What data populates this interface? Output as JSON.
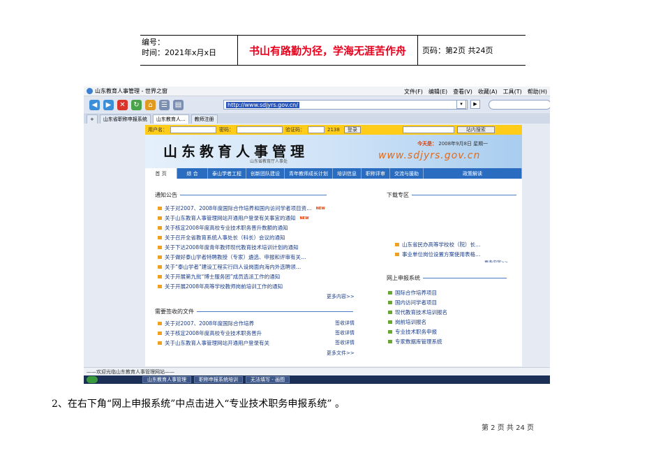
{
  "doc_header": {
    "number_label": "编号：",
    "time_label": "时间：2021年x月x日",
    "motto": "书山有路勤为径，学海无涯苦作舟",
    "page_label": "页码：第2页 共24页"
  },
  "browser": {
    "title": "山东教育人事管理 - 世界之窗",
    "menus": [
      "文件(F)",
      "编辑(E)",
      "查看(V)",
      "收藏(A)",
      "工具(T)",
      "帮助(H)"
    ],
    "address": "http://www.sdjyrs.gov.cn/",
    "tabs": [
      "山东省职称申报系统",
      "山东教育人...",
      "教师注册"
    ]
  },
  "site": {
    "login": {
      "user_label": "用户名：",
      "password_label": "密码：",
      "captcha_label": "验证码：",
      "captcha_value": "2138",
      "login_button": "登录",
      "search_button": "站内搜索"
    },
    "title": "山东教育人事管理",
    "subtitle": "山东省教育厅人事处",
    "today_label": "今天是：",
    "today_value": "2008年9月8日  星期一",
    "url": "www.sdjyrs.gov.cn",
    "nav": [
      "首 页",
      "综  合",
      "泰山学者工程",
      "创新团队建设",
      "青年教师成长计划",
      "培训信息",
      "职称评审",
      "交流与援助",
      "政策解读"
    ],
    "notice": {
      "title": "通知公告",
      "new_badge": "NEW",
      "items": [
        "关于对2007、2008年度国际合作培养和国内访问学者项目资…",
        "关于山东教育人事管理网站开通用户登录有关事宜的通知",
        "关于核定2008年度高校专业技术职务晋升数额的通知",
        "关于召开全省教育系统人事处长（科长）会议的通知",
        "关于下达2008年度青年教师现代教育技术培训计划的通知",
        "关于做好泰山学者特聘教授（专家）遴选、申报和评审有关…",
        "关于“泰山学者”建设工程实行四人设岗面向海内外选聘领…",
        "关于开展第九批“博士服务团”成员选派工作的通知",
        "关于开展2008年高等学校教师岗前培训工作的通知"
      ],
      "more": "更多内容>>"
    },
    "download": {
      "title": "下载专区",
      "items": [
        "山东省民办高等学校校（院）长…",
        "事业单位岗位设置方案使用表格…"
      ],
      "more": "更多内容>>"
    },
    "sign_files": {
      "title": "需要签收的文件",
      "items": [
        "关于对2007、2008年度国际合作培养",
        "关于核定2008年度高校专业技术职务晋升",
        "关于山东教育人事管理网站开通用户登录有关"
      ],
      "action": "签收详情",
      "more": "更多文件>>"
    },
    "online": {
      "title": "网上申报系统",
      "items": [
        "国际合作培养项目",
        "国内访问学者项目",
        "现代教育技术培训报名",
        "岗前培训报名",
        "专业技术职务申报",
        "专家数据库管理系统"
      ]
    },
    "status": "——欢迎光临山东教育人事管理网站——"
  },
  "taskbar": [
    "山东教育人事管理",
    "职称申报系统培训",
    "无法填写 - 画图"
  ],
  "step_text": "2、在右下角“网上申报系统”中点击进入“专业技术职务申报系统” 。",
  "footer": "第 2 页 共 24 页"
}
